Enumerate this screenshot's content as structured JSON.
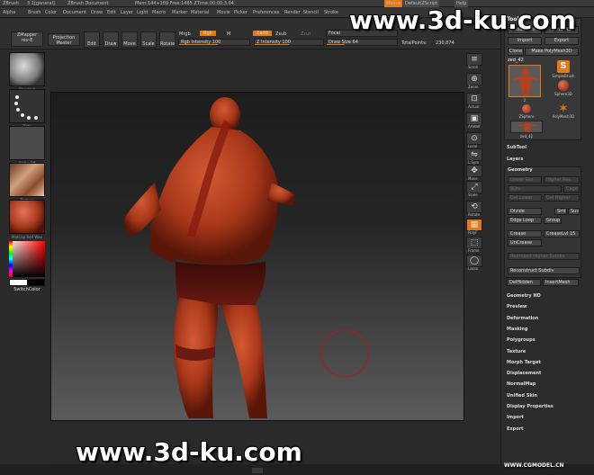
{
  "titlebar": {
    "app": "ZBrush",
    "version": "3.1[general]",
    "document": "ZBrush Document",
    "stats": "Mem:144+169  Free:1465  ZTime:00:00:3.04",
    "menus_btn": "Menus",
    "script_btn": "DefaultZScript",
    "help_btn": "Help"
  },
  "menubar": [
    "Alpha",
    "Brush",
    "Color",
    "Document",
    "Draw",
    "Edit",
    "Layer",
    "Light",
    "Macro",
    "Marker",
    "Material",
    "Movie",
    "Picker",
    "Preferences",
    "Render",
    "Stencil",
    "Stroke"
  ],
  "toolbar": {
    "zmapper": "ZMapper",
    "zmapper_sub": "rev-E",
    "projection_master": "Projection Master",
    "edit": "Edit",
    "draw": "Draw",
    "move": "Move",
    "scale": "Scale",
    "rotate": "Rotate",
    "mrgb": "Mrgb",
    "rgb": "Rgb",
    "m": "M",
    "rgb_intensity_label": "Rgb  Intensity",
    "rgb_intensity": "100",
    "zadd": "Zadd",
    "zsub": "Zsub",
    "zcut": "Zcut",
    "z_intensity_label": "Z  Intensity",
    "z_intensity": "100",
    "focal_label": "Focal",
    "draw_size_label": "Draw Size",
    "draw_size": "64",
    "total_points_label": "TotalPoints:",
    "total_points": "230,874",
    "rgb_intensity_level": 0.55,
    "z_intensity_level": 0.5,
    "draw_size_level": 0.25
  },
  "left_shelf": {
    "brush_label": "Standard",
    "stroke_label": "Dots",
    "alpha_label": "Alpha Off",
    "texture_label": "Texture",
    "material_label": "MatCap Red Wax",
    "switch_color": "SwitchColor"
  },
  "right_shelf": [
    "Scroll",
    "Zoom",
    "Actual",
    "AAHalf",
    "Local",
    "L.Sym",
    "Move",
    "Scale",
    "Rotate",
    "PolyF",
    "Frame",
    "Lasso"
  ],
  "tool_panel": {
    "title": "Tool",
    "load_tool": "Load Tool",
    "save_as": "Save As",
    "import": "Import",
    "export": "Export",
    "clone": "Clone",
    "make_polymesh": "Make PolyMesh3D",
    "current_tool": "zed_42",
    "tool_count": "2",
    "simple_brush": "SimpleBrush",
    "sphere3d": "Sphere3D",
    "zsphere": "ZSphere",
    "polymesh3d": "PolyMesh3D",
    "thumb_small": "zed_42"
  },
  "subtool": "SubTool",
  "layers": "Layers",
  "geometry": {
    "title": "Geometry",
    "lower_res": "Lower Res",
    "higher_res": "Higher Res",
    "sdiv": "SDiv",
    "cage": "Cage",
    "del_lower": "Del Lower",
    "del_higher": "Del Higher",
    "divide": "Divide",
    "smt": "Smt",
    "suv": "Suv",
    "edge_loop": "Edge Loop",
    "group": "Group",
    "crease": "Crease",
    "creaselvl_label": "CreaseLvl",
    "creaselvl": "15",
    "uncrease": "UnCrease",
    "reproject": "Reproject Higher Subdiv",
    "reconstruct": "Reconstruct Subdiv",
    "delhidden": "DelHidden",
    "insertmesh": "InsertMesh"
  },
  "palettes": [
    "Geometry HD",
    "Preview",
    "Deformation",
    "Masking",
    "Polygroups",
    "Texture",
    "Morph Target",
    "Displacement",
    "NormalMap",
    "Unified Skin",
    "Display Properties",
    "Import",
    "Export"
  ],
  "watermarks": {
    "top": "www.3d-ku.com",
    "bottom": "www.3d-ku.com",
    "corner": "WWW.CGMODEL.CN"
  },
  "colors": {
    "accent": "#e47a17",
    "model_skin": "#b03a1c",
    "model_shorts": "#5e1410"
  }
}
